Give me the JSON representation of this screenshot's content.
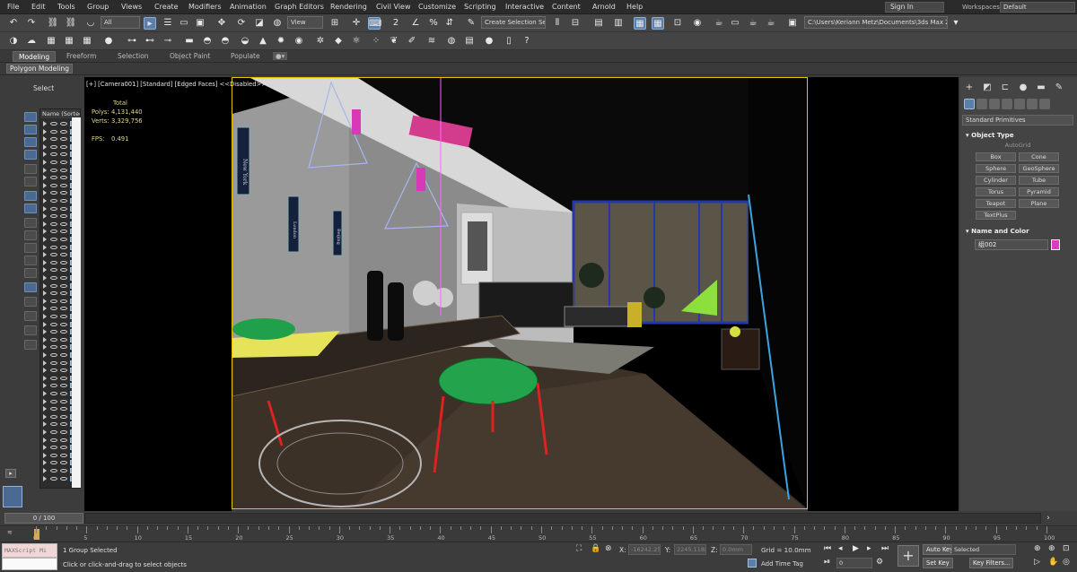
{
  "menu": [
    "File",
    "Edit",
    "Tools",
    "Group",
    "Views",
    "Create",
    "Modifiers",
    "Animation",
    "Graph Editors",
    "Rendering",
    "Civil View",
    "Customize",
    "Scripting",
    "Interactive",
    "Content",
    "Arnold",
    "Help"
  ],
  "signin": "Sign In",
  "workspaces_label": "Workspaces:",
  "workspaces_value": "Default",
  "toolbar": {
    "filter": "All",
    "refcoord": "View",
    "named_selection": "Create Selection Se",
    "project_path": "C:\\Users\\Keriann Metz\\Documents\\3ds Max 2020"
  },
  "ribbon_tabs": [
    "Modeling",
    "Freeform",
    "Selection",
    "Object Paint",
    "Populate"
  ],
  "polygon_modeling": "Polygon Modeling",
  "scene_explorer": {
    "title": "Select",
    "column": "Name (Sorted A"
  },
  "viewport": {
    "label": "[+] [Camera001] [Standard] [Edged Faces]  <<Disabled>>",
    "stats_total": "Total",
    "polys_label": "Polys:",
    "polys_value": "4,131,440",
    "verts_label": "Verts:",
    "verts_value": "3,329,756",
    "fps_label": "FPS:",
    "fps_value": "0.491",
    "posters": [
      "New York",
      "London",
      "Beijing"
    ]
  },
  "command_panel": {
    "dropdown": "Standard Primitives",
    "object_type": "Object Type",
    "autogrid": "AutoGrid",
    "buttons": [
      "Box",
      "Cone",
      "Sphere",
      "GeoSphere",
      "Cylinder",
      "Tube",
      "Torus",
      "Pyramid",
      "Teapot",
      "Plane",
      "TextPlus"
    ],
    "name_color": "Name and Color",
    "name_value": "组002",
    "color": "#d63fbf"
  },
  "timeline": {
    "frame": "0 / 100",
    "ticks": [
      "0",
      "5",
      "10",
      "15",
      "20",
      "25",
      "30",
      "35",
      "40",
      "45",
      "50",
      "55",
      "60",
      "65",
      "70",
      "75",
      "80",
      "85",
      "90",
      "95",
      "100"
    ]
  },
  "status": {
    "maxscript": "MAXScript Mi",
    "selected": "1 Group Selected",
    "prompt": "Click or click-and-drag to select objects",
    "x_value": "-16242.257",
    "y_value": "2245.118m",
    "z_value": "0.0mm",
    "grid": "Grid = 10.0mm",
    "add_time_tag": "Add Time Tag",
    "auto_key": "Auto Key",
    "selected_dd": "Selected",
    "set_key": "Set Key",
    "key_filters": "Key Filters...",
    "current_frame": "0"
  }
}
